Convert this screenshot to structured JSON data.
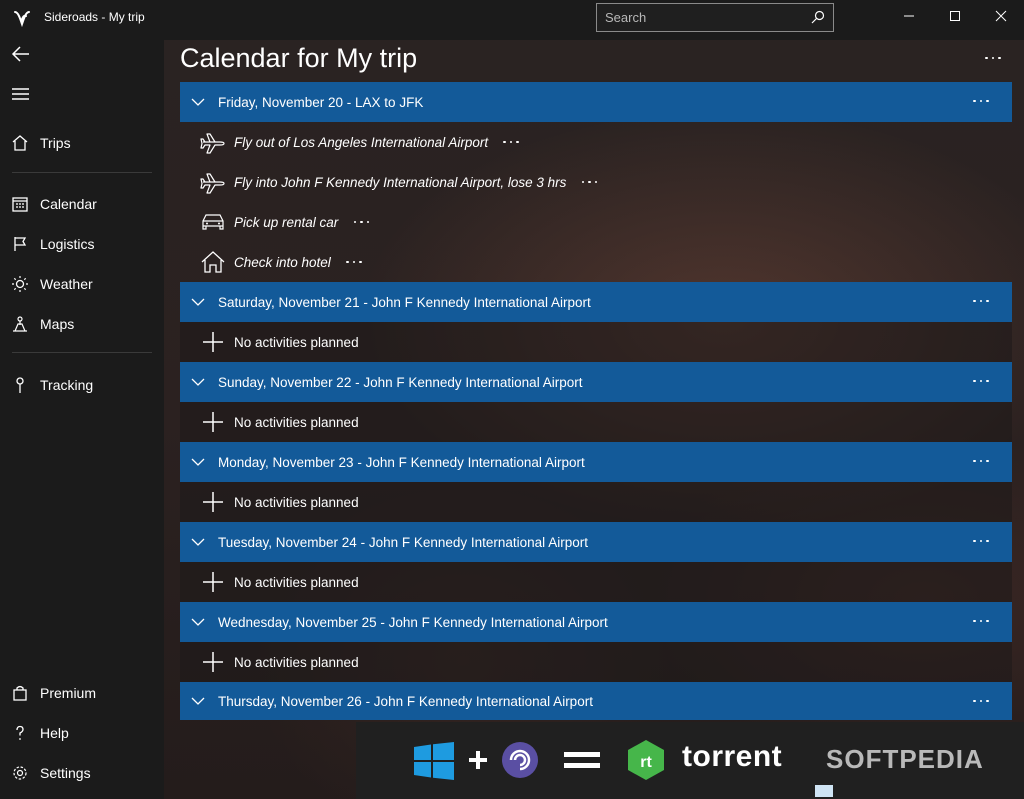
{
  "app": {
    "title": "Sideroads - My trip"
  },
  "search": {
    "placeholder": "Search"
  },
  "page": {
    "title": "Calendar for My trip"
  },
  "nav": {
    "items": [
      {
        "label": "Trips",
        "icon": "home-icon"
      },
      {
        "label": "Calendar",
        "icon": "calendar-icon"
      },
      {
        "label": "Logistics",
        "icon": "flag-icon"
      },
      {
        "label": "Weather",
        "icon": "sun-icon"
      },
      {
        "label": "Maps",
        "icon": "map-pin-person-icon"
      },
      {
        "label": "Tracking",
        "icon": "location-pin-icon"
      }
    ],
    "bottom": [
      {
        "label": "Premium",
        "icon": "bag-icon"
      },
      {
        "label": "Help",
        "icon": "question-icon"
      },
      {
        "label": "Settings",
        "icon": "gear-icon"
      }
    ]
  },
  "days": [
    {
      "header": "Friday, November 20 - LAX to JFK",
      "activities": [
        {
          "text": "Fly out of Los Angeles International Airport",
          "icon": "airplane-icon"
        },
        {
          "text": "Fly into John F Kennedy International Airport, lose 3 hrs",
          "icon": "airplane-icon"
        },
        {
          "text": "Pick up rental car",
          "icon": "car-icon"
        },
        {
          "text": "Check into hotel",
          "icon": "house-icon"
        }
      ]
    },
    {
      "header": "Saturday, November 21 - John F Kennedy International Airport",
      "empty": "No activities planned"
    },
    {
      "header": "Sunday, November 22 - John F Kennedy International Airport",
      "empty": "No activities planned"
    },
    {
      "header": "Monday, November 23 - John F Kennedy International Airport",
      "empty": "No activities planned"
    },
    {
      "header": "Tuesday, November 24 - John F Kennedy International Airport",
      "empty": "No activities planned"
    },
    {
      "header": "Wednesday, November 25 - John F Kennedy International Airport",
      "empty": "No activities planned"
    },
    {
      "header": "Thursday, November 26 - John F Kennedy International Airport"
    }
  ],
  "banner": {
    "brand": "torrent",
    "watermark": "SOFTPEDIA"
  },
  "colors": {
    "header_blue": "#135a99",
    "sidebar": "#1b1b1b"
  }
}
